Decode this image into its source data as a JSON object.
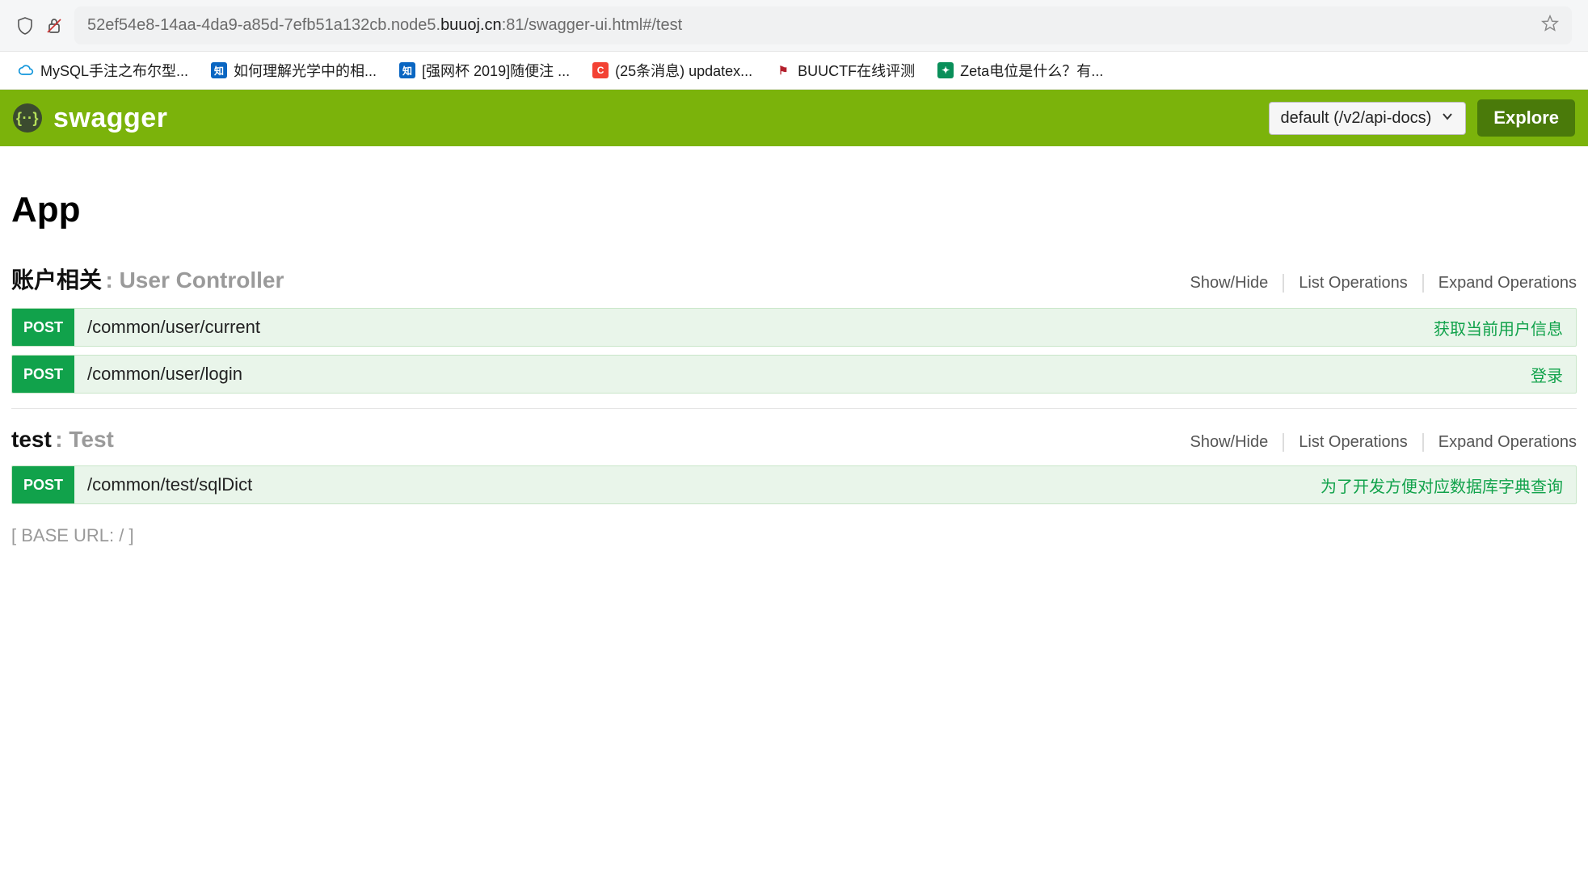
{
  "browser": {
    "url_prefix": "52ef54e8-14aa-4da9-a85d-7efb51a132cb.node5.",
    "url_domain": "buuoj.cn",
    "url_suffix": ":81/swagger-ui.html#/test"
  },
  "bookmarks": [
    {
      "label": "MySQL手注之布尔型...",
      "icon": "cloud"
    },
    {
      "label": "如何理解光学中的相...",
      "icon": "zhihu",
      "glyph": "知"
    },
    {
      "label": "[强网杯 2019]随便注 ...",
      "icon": "zhihu",
      "glyph": "知"
    },
    {
      "label": "(25条消息) updatex...",
      "icon": "csdn",
      "glyph": "C"
    },
    {
      "label": "BUUCTF在线评测",
      "icon": "buu",
      "glyph": "⚑"
    },
    {
      "label": "Zeta电位是什么？有...",
      "icon": "zeta",
      "glyph": "✦"
    }
  ],
  "swagger": {
    "brand": "swagger",
    "api_selector": "default (/v2/api-docs)",
    "explore_label": "Explore"
  },
  "page": {
    "title": "App",
    "base_url_label": "[ BASE URL: / ]"
  },
  "controller_actions": {
    "show_hide": "Show/Hide",
    "list_ops": "List Operations",
    "expand_ops": "Expand Operations"
  },
  "controllers": [
    {
      "name": "账户相关",
      "sub": ": User Controller",
      "operations": [
        {
          "method": "POST",
          "path": "/common/user/current",
          "desc": "获取当前用户信息"
        },
        {
          "method": "POST",
          "path": "/common/user/login",
          "desc": "登录"
        }
      ]
    },
    {
      "name": "test",
      "sub": " : Test",
      "operations": [
        {
          "method": "POST",
          "path": "/common/test/sqlDict",
          "desc": "为了开发方便对应数据库字典查询"
        }
      ]
    }
  ]
}
